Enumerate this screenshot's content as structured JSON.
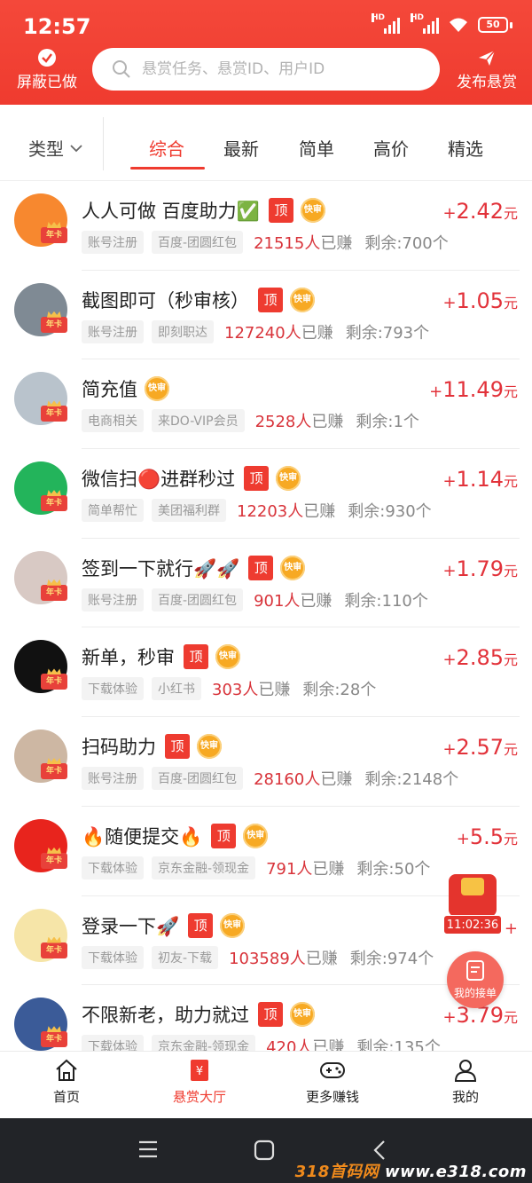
{
  "status_bar": {
    "time": "12:57",
    "signal_1": "HD",
    "signal_2": "HD",
    "battery": "50"
  },
  "header": {
    "block_done_label": "屏蔽已做",
    "search_placeholder": "悬赏任务、悬赏ID、用户ID",
    "publish_label": "发布悬赏"
  },
  "filter": {
    "type_label": "类型",
    "tabs": [
      {
        "label": "综合",
        "active": true
      },
      {
        "label": "最新",
        "active": false
      },
      {
        "label": "简单",
        "active": false
      },
      {
        "label": "高价",
        "active": false
      },
      {
        "label": "精选",
        "active": false
      }
    ]
  },
  "tags": {
    "top": "顶",
    "fast": "快审",
    "vip_year": "年卡"
  },
  "tasks": [
    {
      "title": "人人可做 百度助力✅",
      "top": true,
      "fast": true,
      "category": "账号注册",
      "source": "百度-团圆红包",
      "earned_count": "21515人",
      "earned_suffix": "已赚",
      "remaining": "剩余:700个",
      "price_plus": "+",
      "price": "2.42",
      "unit": "元",
      "avatar_icon": "orange-circle-icon",
      "avatar_color": "#f7882f"
    },
    {
      "title": "截图即可（秒审核）",
      "top": true,
      "fast": true,
      "category": "账号注册",
      "source": "即刻职达",
      "earned_count": "127240人",
      "earned_suffix": "已赚",
      "remaining": "剩余:793个",
      "price_plus": "+",
      "price": "1.05",
      "unit": "元",
      "avatar_icon": "photo-avatar-icon",
      "avatar_color": "#7f8a94"
    },
    {
      "title": "简充值",
      "top": false,
      "fast": true,
      "category": "电商相关",
      "source": "来DO-VIP会员",
      "earned_count": "2528人",
      "earned_suffix": "已赚",
      "remaining": "剩余:1个",
      "price_plus": "+",
      "price": "11.49",
      "unit": "元",
      "avatar_icon": "sky-photo-icon",
      "avatar_color": "#b9c3cc"
    },
    {
      "title": "微信扫🔴进群秒过",
      "top": true,
      "fast": true,
      "category": "简单帮忙",
      "source": "美团福利群",
      "earned_count": "12203人",
      "earned_suffix": "已赚",
      "remaining": "剩余:930个",
      "price_plus": "+",
      "price": "1.14",
      "unit": "元",
      "avatar_icon": "earn-coins-logo-icon",
      "avatar_color": "#23b45b"
    },
    {
      "title": "签到一下就行🚀🚀",
      "top": true,
      "fast": true,
      "category": "账号注册",
      "source": "百度-团圆红包",
      "earned_count": "901人",
      "earned_suffix": "已赚",
      "remaining": "剩余:110个",
      "price_plus": "+",
      "price": "1.79",
      "unit": "元",
      "avatar_icon": "portrait-photo-icon",
      "avatar_color": "#d8c9c4"
    },
    {
      "title": "新单，秒审",
      "top": true,
      "fast": true,
      "category": "下载体验",
      "source": "小红书",
      "earned_count": "303人",
      "earned_suffix": "已赚",
      "remaining": "剩余:28个",
      "price_plus": "+",
      "price": "2.85",
      "unit": "元",
      "avatar_icon": "app-download-poster-icon",
      "avatar_color": "#111111"
    },
    {
      "title": "扫码助力",
      "top": true,
      "fast": true,
      "category": "账号注册",
      "source": "百度-团圆红包",
      "earned_count": "28160人",
      "earned_suffix": "已赚",
      "remaining": "剩余:2148个",
      "price_plus": "+",
      "price": "2.57",
      "unit": "元",
      "avatar_icon": "child-photo-icon",
      "avatar_color": "#cdb7a3"
    },
    {
      "title": "🔥随便提交🔥",
      "top": true,
      "fast": true,
      "category": "下载体验",
      "source": "京东金融-领现金",
      "earned_count": "791人",
      "earned_suffix": "已赚",
      "remaining": "剩余:50个",
      "price_plus": "+",
      "price": "5.5",
      "unit": "元",
      "avatar_icon": "zhuan-character-icon",
      "avatar_color": "#e8241d"
    },
    {
      "title": "登录一下🚀",
      "top": true,
      "fast": true,
      "category": "下载体验",
      "source": "初友-下载",
      "earned_count": "103589人",
      "earned_suffix": "已赚",
      "remaining": "剩余:974个",
      "price_plus": "+",
      "price": "",
      "unit": "",
      "avatar_icon": "dragon-mascot-icon",
      "avatar_color": "#f6e5a8"
    },
    {
      "title": "不限新老，助力就过",
      "top": true,
      "fast": true,
      "category": "下载体验",
      "source": "京东金融-领现金",
      "earned_count": "420人",
      "earned_suffix": "已赚",
      "remaining": "剩余:135个",
      "price_plus": "+",
      "price": "3.79",
      "unit": "元",
      "avatar_icon": "facebook-logo-icon",
      "avatar_color": "#3b5b98"
    }
  ],
  "floating": {
    "timer": "11:02:36",
    "my_orders_label": "我的接单"
  },
  "bottom_nav": [
    {
      "label": "首页",
      "icon": "home-icon",
      "active": false
    },
    {
      "label": "悬赏大厅",
      "icon": "reward-hall-icon",
      "active": true
    },
    {
      "label": "更多赚钱",
      "icon": "gamepad-icon",
      "active": false
    },
    {
      "label": "我的",
      "icon": "user-icon",
      "active": false
    }
  ],
  "watermark": {
    "prefix": "318首码网",
    "domain": "www.e318.com"
  },
  "colors": {
    "brand_red": "#ef3b2f",
    "price_red": "#e2323a",
    "fast_orange": "#f7a923"
  }
}
